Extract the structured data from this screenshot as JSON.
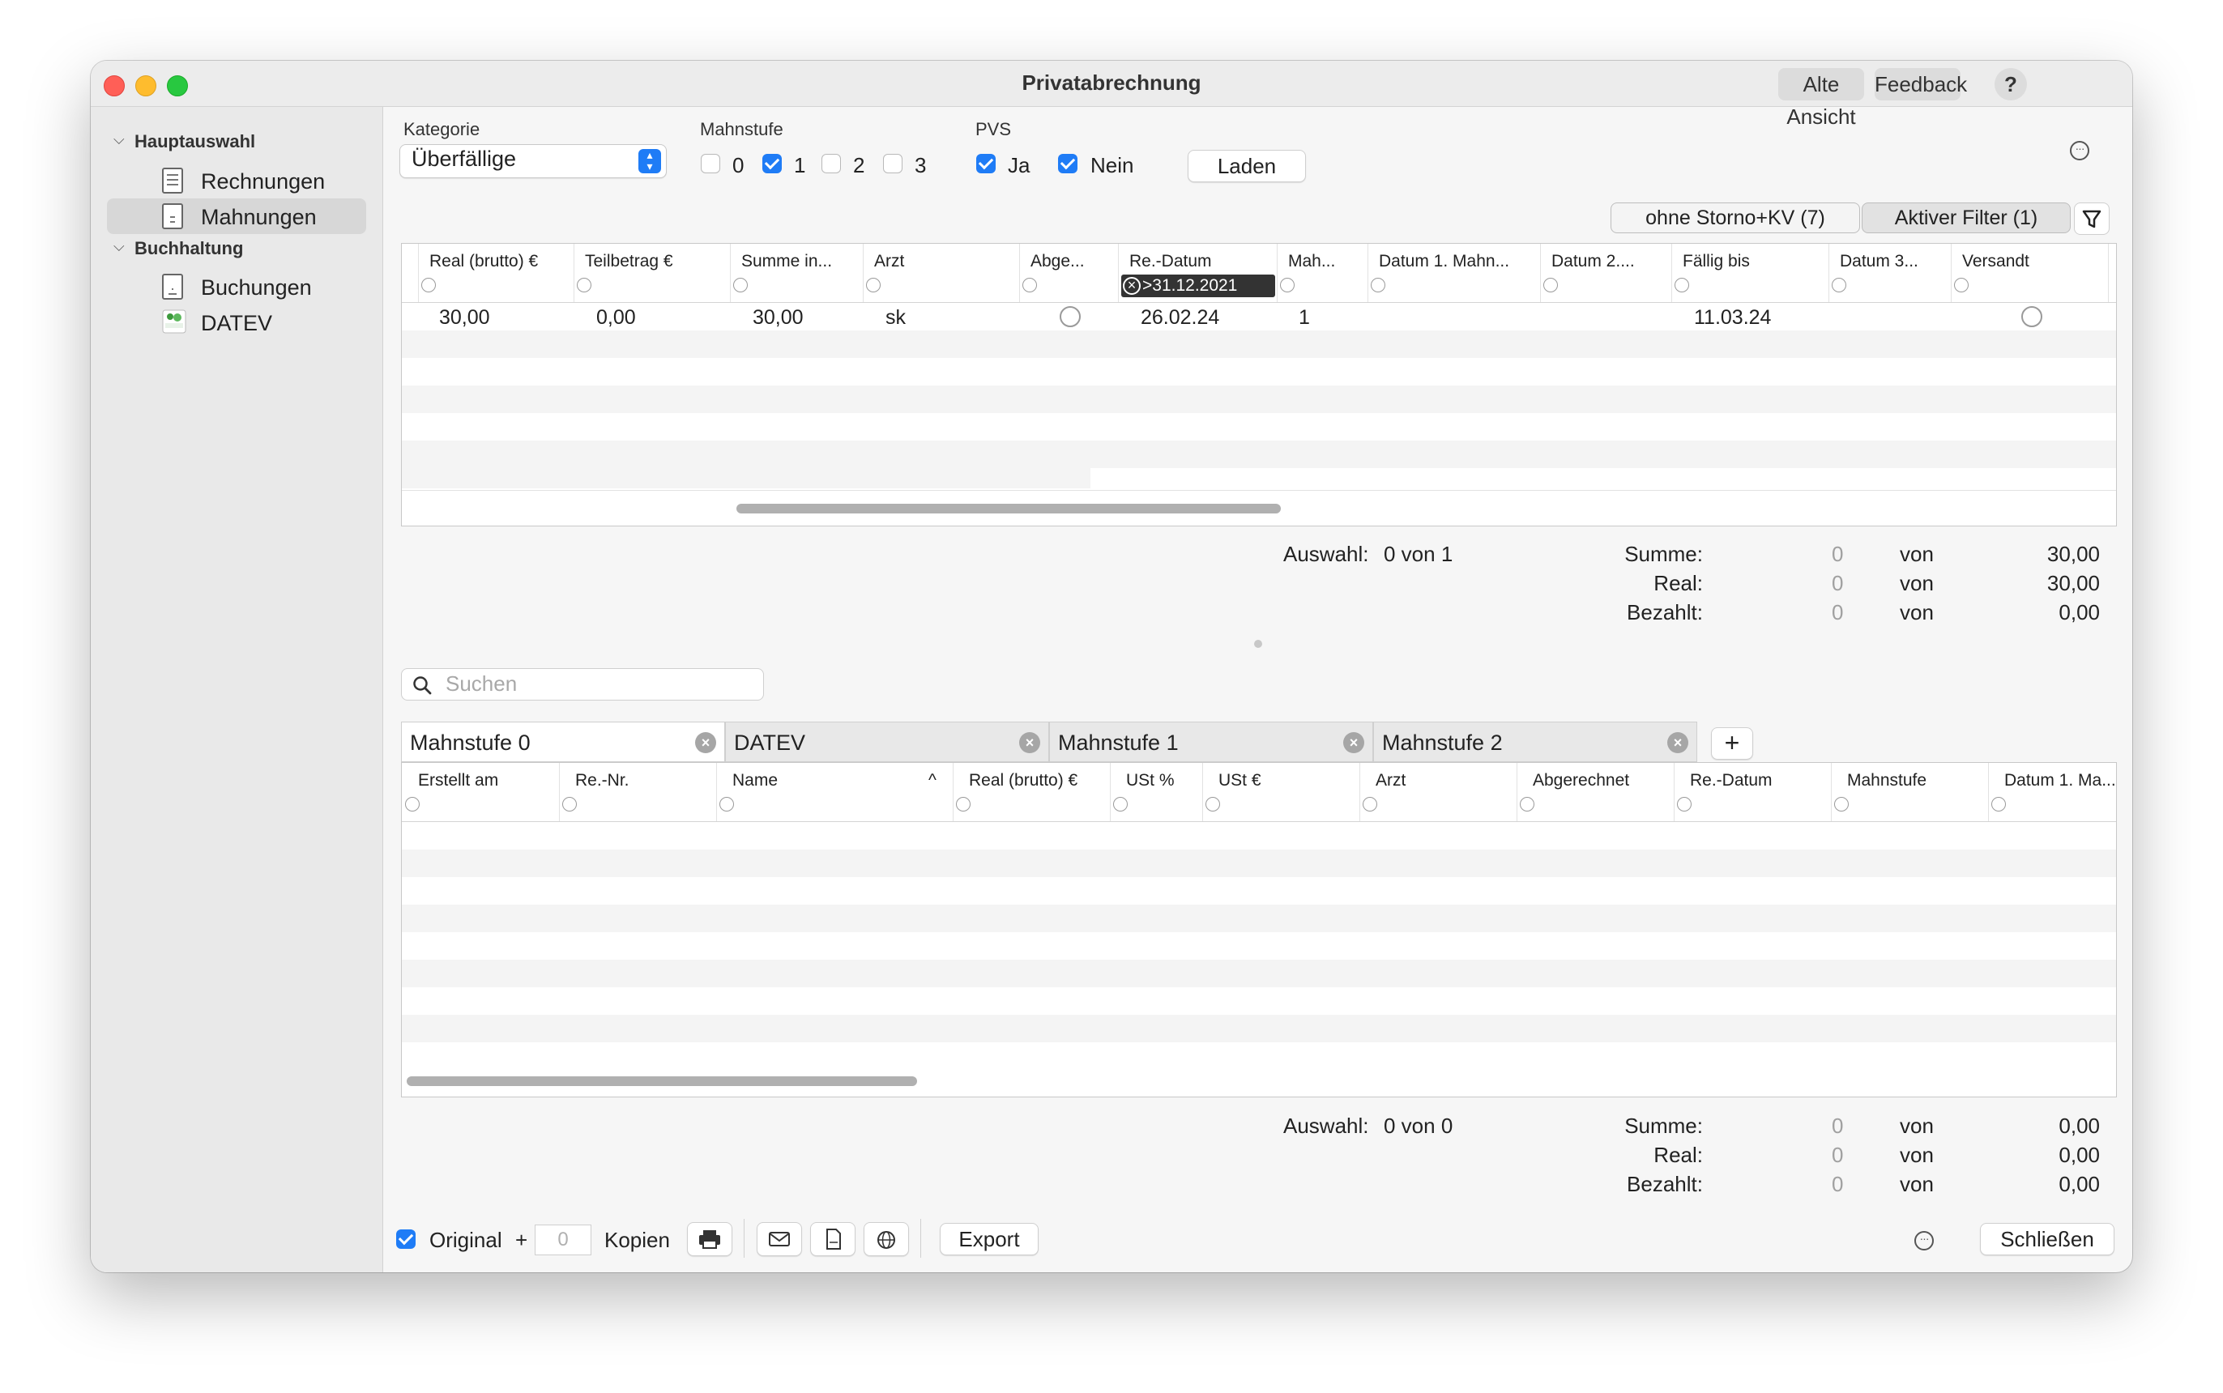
{
  "window": {
    "title": "Privatabrechnung",
    "buttons": {
      "old_view": "Alte Ansicht",
      "feedback": "Feedback",
      "help": "?"
    }
  },
  "sidebar": {
    "sections": [
      {
        "label": "Hauptauswahl",
        "items": [
          {
            "label": "Rechnungen",
            "icon": "invoice-icon"
          },
          {
            "label": "Mahnungen",
            "icon": "reminder-icon",
            "selected": true
          }
        ]
      },
      {
        "label": "Buchhaltung",
        "items": [
          {
            "label": "Buchungen",
            "icon": "bookings-icon"
          },
          {
            "label": "DATEV",
            "icon": "datev-icon"
          }
        ]
      }
    ]
  },
  "filters": {
    "kategorie_label": "Kategorie",
    "kategorie_value": "Überfällige",
    "mahnstufe_label": "Mahnstufe",
    "mahnstufe_options": [
      {
        "label": "0",
        "checked": false
      },
      {
        "label": "1",
        "checked": true
      },
      {
        "label": "2",
        "checked": false
      },
      {
        "label": "3",
        "checked": false
      }
    ],
    "pvs_label": "PVS",
    "pvs_options": [
      {
        "label": "Ja",
        "checked": true
      },
      {
        "label": "Nein",
        "checked": true
      }
    ],
    "load_button": "Laden",
    "pill_storno": "ohne Storno+KV (7)",
    "pill_filter": "Aktiver Filter (1)"
  },
  "top_table": {
    "columns": [
      "Real (brutto) €",
      "Teilbetrag €",
      "Summe in...",
      "Arzt",
      "Abge...",
      "Re.-Datum",
      "Mah...",
      "Datum 1. Mahn...",
      "Datum 2....",
      "Fällig bis",
      "Datum 3...",
      "Versandt"
    ],
    "active_filter": ">31.12.2021",
    "rows": [
      {
        "real": "30,00",
        "teilbetrag": "0,00",
        "summe": "30,00",
        "arzt": "sk",
        "re_datum": "26.02.24",
        "mahnstufe": "1",
        "faellig": "11.03.24"
      }
    ]
  },
  "top_summary": {
    "auswahl_label": "Auswahl:",
    "auswahl_value": "0 von 1",
    "summe_label": "Summe:",
    "summe_sel": "0",
    "summe_von": "von",
    "summe_total": "30,00",
    "real_label": "Real:",
    "real_sel": "0",
    "real_von": "von",
    "real_total": "30,00",
    "bezahlt_label": "Bezahlt:",
    "bezahlt_sel": "0",
    "bezahlt_von": "von",
    "bezahlt_total": "0,00"
  },
  "search": {
    "placeholder": "Suchen"
  },
  "tabs": [
    {
      "label": "Mahnstufe 0",
      "active": true
    },
    {
      "label": "DATEV",
      "active": false
    },
    {
      "label": "Mahnstufe 1",
      "active": false
    },
    {
      "label": "Mahnstufe 2",
      "active": false
    }
  ],
  "add_tab": "+",
  "bottom_table": {
    "columns": [
      "Erstellt am",
      "Re.-Nr.",
      "Name",
      "Real (brutto) €",
      "USt %",
      "USt €",
      "Arzt",
      "Abgerechnet",
      "Re.-Datum",
      "Mahnstufe",
      "Datum 1. Ma..."
    ],
    "sort_indicator": "^"
  },
  "bottom_summary": {
    "auswahl_label": "Auswahl:",
    "auswahl_value": "0 von 0",
    "summe_label": "Summe:",
    "summe_sel": "0",
    "summe_von": "von",
    "summe_total": "0,00",
    "real_label": "Real:",
    "real_sel": "0",
    "real_von": "von",
    "real_total": "0,00",
    "bezahlt_label": "Bezahlt:",
    "bezahlt_sel": "0",
    "bezahlt_von": "von",
    "bezahlt_total": "0,00"
  },
  "footer": {
    "original_label": "Original",
    "plus": "+",
    "copies_value": "0",
    "copies_label": "Kopien",
    "export_button": "Export",
    "close_button": "Schließen"
  }
}
